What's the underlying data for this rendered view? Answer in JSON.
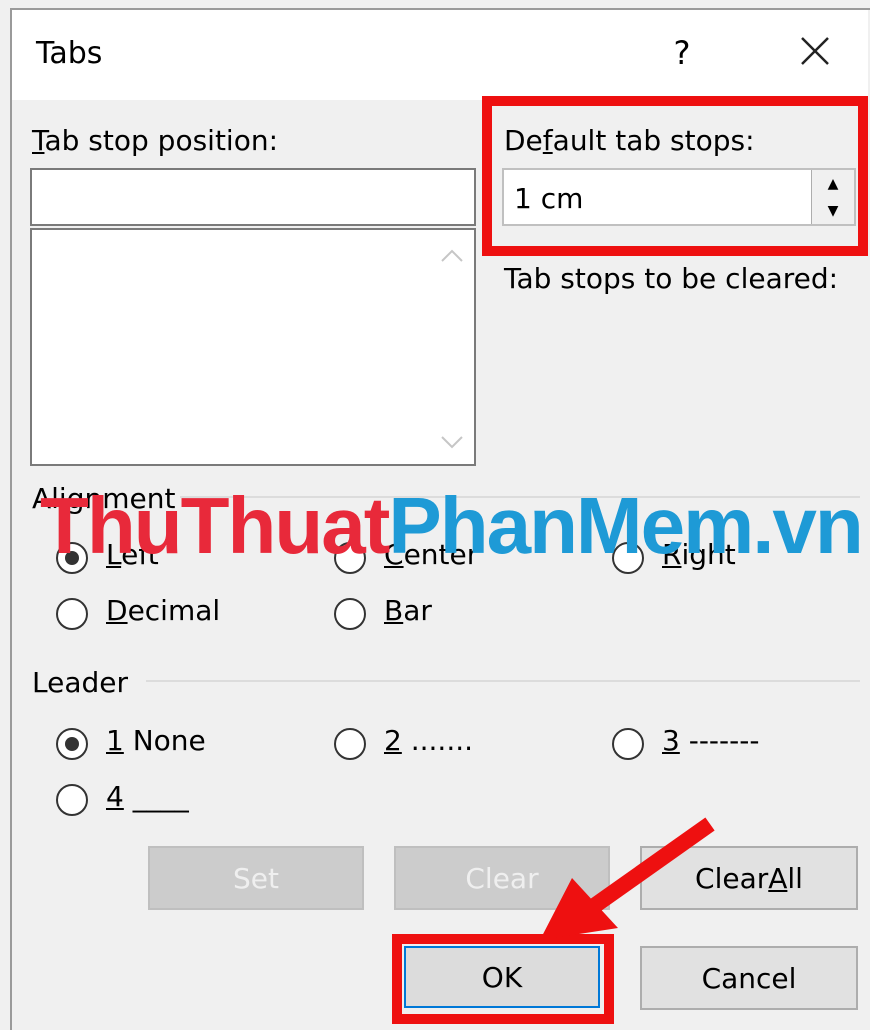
{
  "dialog": {
    "title": "Tabs",
    "help_glyph": "?",
    "close_glyph": "X"
  },
  "tab_stop_position": {
    "label": "Tab stop position:",
    "label_access_key": "T",
    "label_rest": "ab stop position:",
    "value": ""
  },
  "default_tab_stops": {
    "label_pre": "De",
    "label_access_key": "f",
    "label_rest": "ault tab stops:",
    "value": "1 cm"
  },
  "tab_stops_to_be_cleared": {
    "label": "Tab stops to be cleared:"
  },
  "alignment": {
    "label": "Alignment",
    "options": [
      {
        "access_key": "L",
        "rest": "eft",
        "selected": true
      },
      {
        "access_key": "C",
        "rest": "enter",
        "selected": false
      },
      {
        "access_key": "R",
        "rest": "ight",
        "selected": false
      },
      {
        "access_key": "D",
        "rest": "ecimal",
        "selected": false
      },
      {
        "access_key": "B",
        "rest": "ar",
        "selected": false
      }
    ]
  },
  "leader": {
    "label": "Leader",
    "options": [
      {
        "access_key": "1",
        "rest": " None",
        "selected": true
      },
      {
        "access_key": "2",
        "rest": " .......",
        "selected": false
      },
      {
        "access_key": "3",
        "rest": " -------",
        "selected": false
      },
      {
        "access_key": "4",
        "rest": " ____",
        "selected": false
      }
    ]
  },
  "buttons": {
    "set": "Set",
    "clear": "Clear",
    "clear_all_pre": "Clear ",
    "clear_all_key": "A",
    "clear_all_rest": "ll",
    "ok": "OK",
    "cancel": "Cancel"
  },
  "watermark": {
    "part1": "ThuThuat",
    "part2": "PhanMem",
    "part3": ".vn",
    "color1": "#e8293a",
    "color2": "#1e9ad6"
  },
  "colors": {
    "highlight": "#ee1010",
    "arrow": "#ee1010"
  }
}
